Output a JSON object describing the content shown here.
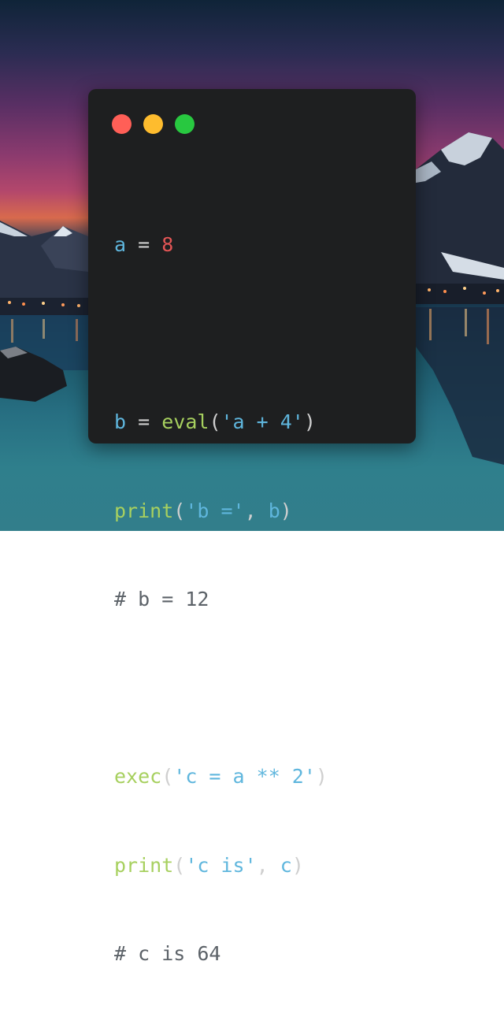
{
  "theme": {
    "window_bg": "#1e1f20",
    "dot_red": "#ff5f57",
    "dot_yellow": "#febc2e",
    "dot_green": "#28c840",
    "variable_color": "#5fb6dd",
    "number_color": "#e35555",
    "function_color": "#a7d05f",
    "comment_color": "#5c6268"
  },
  "window": {
    "controls": [
      {
        "name": "close-dot",
        "icon": "red-circle"
      },
      {
        "name": "minimize-dot",
        "icon": "yellow-circle"
      },
      {
        "name": "zoom-dot",
        "icon": "green-circle"
      }
    ]
  },
  "code": {
    "line1": {
      "var": "a",
      "op": " = ",
      "num": "8"
    },
    "line2": {
      "var": "b",
      "op": " = ",
      "fn": "eval",
      "open": "(",
      "str": "'a + 4'",
      "close": ")"
    },
    "line3": {
      "fn": "print",
      "open": "(",
      "str": "'b ='",
      "sep": ", ",
      "var": "b",
      "close": ")"
    },
    "line4": {
      "comment": "# b = 12"
    },
    "line5": {
      "fn": "exec",
      "open": "(",
      "str": "'c = a ** 2'",
      "close": ")"
    },
    "line6": {
      "fn": "print",
      "open": "(",
      "str": "'c is'",
      "sep": ", ",
      "var": "c",
      "close": ")"
    },
    "line7": {
      "comment": "# c is 64"
    }
  }
}
